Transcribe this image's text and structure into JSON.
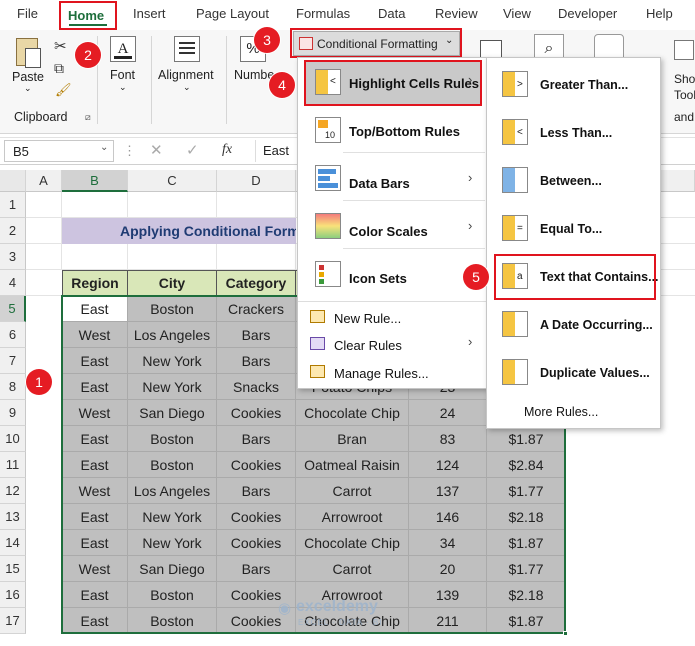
{
  "ribbon_tabs": [
    "File",
    "Home",
    "Insert",
    "Page Layout",
    "Formulas",
    "Data",
    "Review",
    "View",
    "Developer",
    "Help"
  ],
  "groups": {
    "paste": "Paste",
    "clipboard": "Clipboard",
    "font": "Font",
    "alignment": "Alignment",
    "number": "Numbe",
    "right_top": "Show",
    "right_mid": "ToolP",
    "right_bot": "and"
  },
  "name_box": "B5",
  "formula": "East",
  "fx": "fx",
  "title": "Applying Conditional Formatting",
  "cf_button": "Conditional Formatting",
  "menu": [
    {
      "label": "Highlight Cells Rules",
      "underline": "H"
    },
    {
      "label": "Top/Bottom Rules",
      "underline": "T"
    },
    {
      "label": "Data Bars",
      "underline": "D"
    },
    {
      "label": "Color Scales",
      "underline": "S"
    },
    {
      "label": "Icon Sets",
      "underline": "I"
    },
    {
      "label": "New Rule...",
      "underline": "N"
    },
    {
      "label": "Clear Rules",
      "underline": "C"
    },
    {
      "label": "Manage Rules...",
      "underline": "R"
    }
  ],
  "submenu": [
    "Greater Than...",
    "Less Than...",
    "Between...",
    "Equal To...",
    "Text that Contains...",
    "A Date Occurring...",
    "Duplicate Values...",
    "More Rules..."
  ],
  "columns": [
    "A",
    "B",
    "C",
    "D"
  ],
  "rows": [
    "1",
    "2",
    "3",
    "4",
    "5",
    "6",
    "7",
    "8",
    "9",
    "10",
    "11",
    "12",
    "13",
    "14",
    "15",
    "16",
    "17"
  ],
  "headers": [
    "Region",
    "City",
    "Category"
  ],
  "table": [
    [
      "East",
      "Boston",
      "Crackers",
      "",
      "",
      ""
    ],
    [
      "West",
      "Los Angeles",
      "Bars",
      "",
      "",
      ""
    ],
    [
      "East",
      "New York",
      "Bars",
      "",
      "",
      ""
    ],
    [
      "East",
      "New York",
      "Snacks",
      "Potato Chips",
      "23",
      ""
    ],
    [
      "West",
      "San Diego",
      "Cookies",
      "Chocolate Chip",
      "24",
      ""
    ],
    [
      "East",
      "Boston",
      "Bars",
      "Bran",
      "83",
      "$1.87"
    ],
    [
      "East",
      "Boston",
      "Cookies",
      "Oatmeal Raisin",
      "124",
      "$2.84"
    ],
    [
      "West",
      "Los Angeles",
      "Bars",
      "Carrot",
      "137",
      "$1.77"
    ],
    [
      "East",
      "New York",
      "Cookies",
      "Arrowroot",
      "146",
      "$2.18"
    ],
    [
      "East",
      "New York",
      "Cookies",
      "Chocolate Chip",
      "34",
      "$1.87"
    ],
    [
      "West",
      "San Diego",
      "Bars",
      "Carrot",
      "20",
      "$1.77"
    ],
    [
      "East",
      "Boston",
      "Cookies",
      "Arrowroot",
      "139",
      "$2.18"
    ],
    [
      "East",
      "Boston",
      "Cookies",
      "Chocolate Chip",
      "211",
      "$1.87"
    ]
  ],
  "badges": [
    "1",
    "2",
    "3",
    "4",
    "5"
  ],
  "watermark": "exceldemy",
  "watermark_sub": "EXCEL · DATA · BI"
}
